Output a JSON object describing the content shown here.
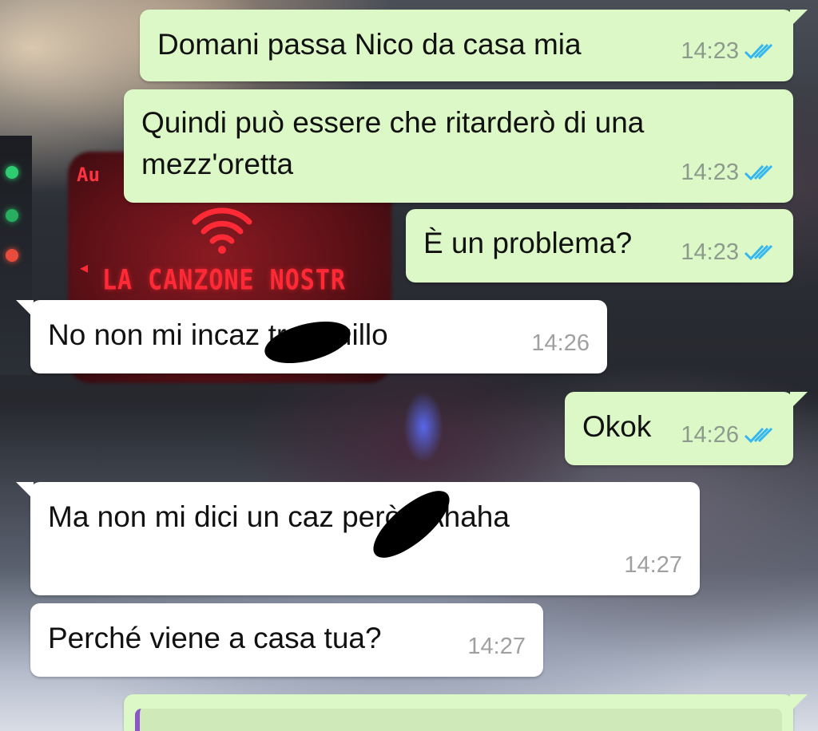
{
  "messages": [
    {
      "direction": "out",
      "text": "Domani passa Nico da casa mia",
      "time": "14:23",
      "status": "read"
    },
    {
      "direction": "out",
      "text": "Quindi può essere che ritarderò di una\nmezz'oretta",
      "time": "14:23",
      "status": "read"
    },
    {
      "direction": "out",
      "text": "È un problema?",
      "time": "14:23",
      "status": "read"
    },
    {
      "direction": "in",
      "text": "No non mi incaz    tranquillo",
      "time": "14:26",
      "censored": true
    },
    {
      "direction": "out",
      "text": "Okok",
      "time": "14:26",
      "status": "read"
    },
    {
      "direction": "in",
      "text": "Ma non mi dici un caz     però? Ahaha",
      "time": "14:27",
      "censored": true
    },
    {
      "direction": "in",
      "text": "Perché viene a casa tua?",
      "time": "14:27"
    }
  ],
  "colors": {
    "outgoing_bubble": "#dcf8c6",
    "incoming_bubble": "#ffffff",
    "read_ticks": "#34b7f1",
    "reply_bar": "#8a56c9"
  },
  "wallpaper": {
    "screen_text": "LA CANZONE NOSTR",
    "screen_top_text": "Au"
  }
}
